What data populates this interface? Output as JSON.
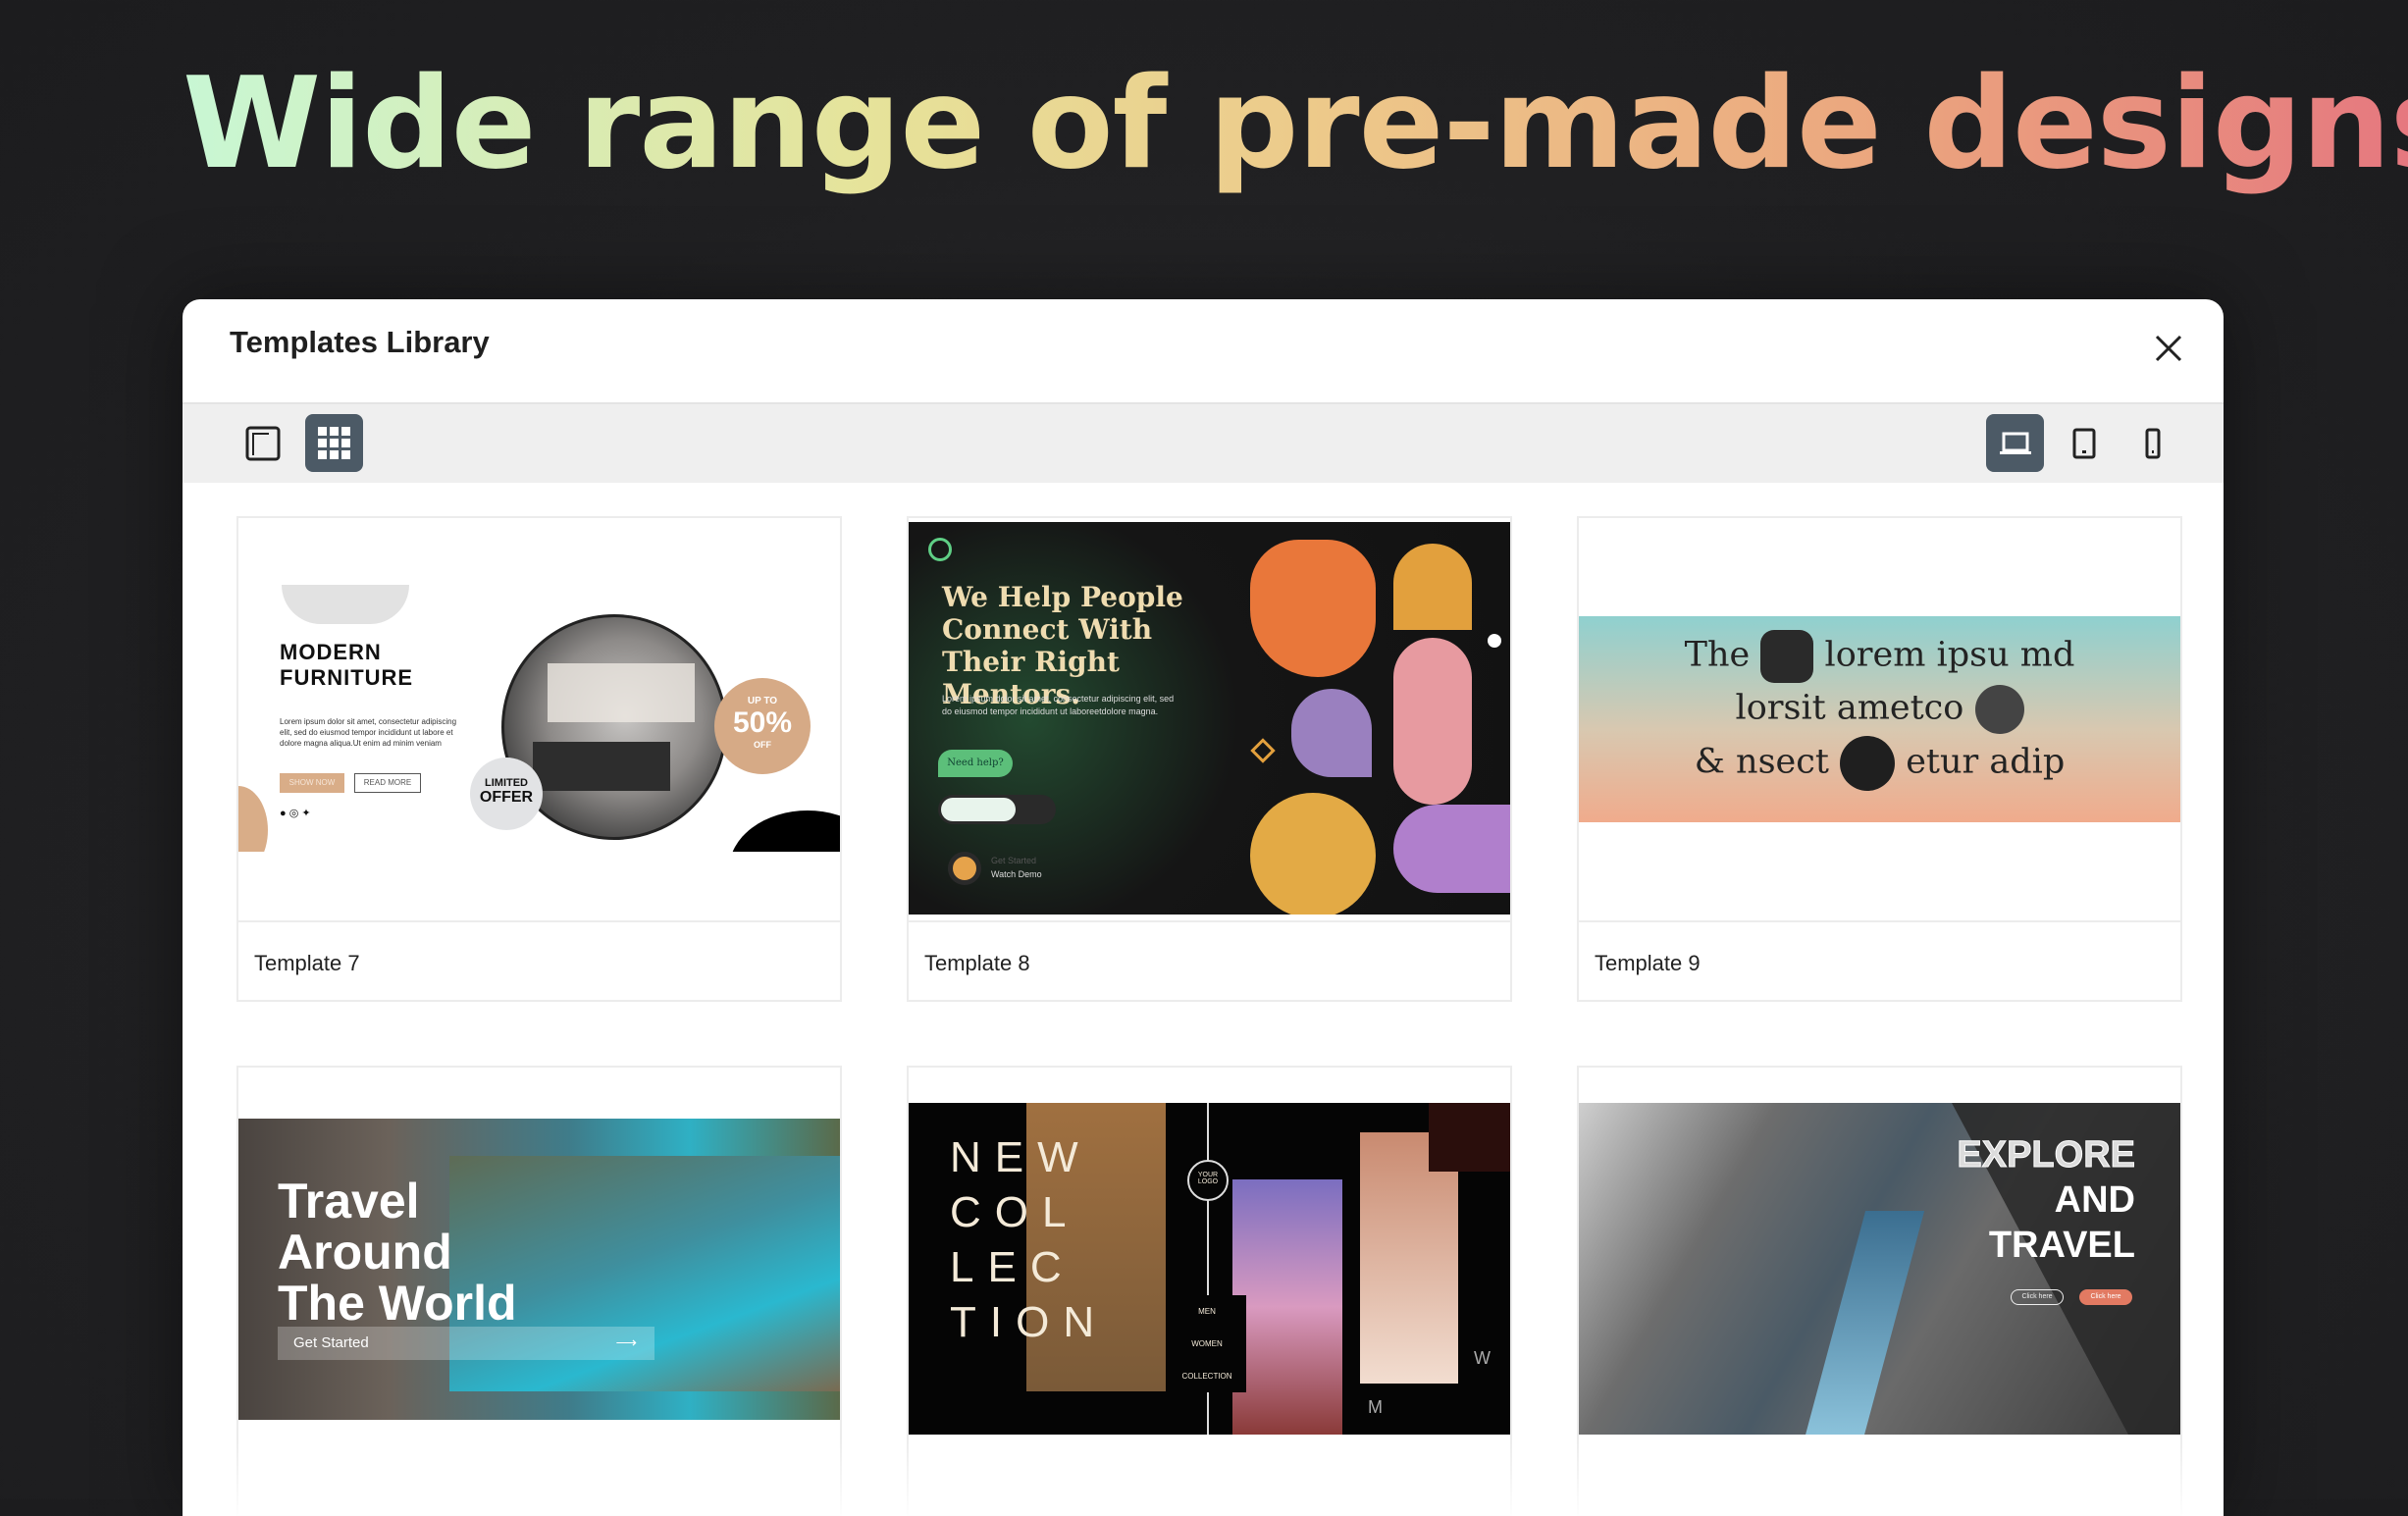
{
  "headline": "Wide range of pre-made designs",
  "modal": {
    "title": "Templates Library",
    "close_icon": "close-icon"
  },
  "toolbar": {
    "view_buttons": [
      {
        "icon": "single-view-icon",
        "active": false
      },
      {
        "icon": "grid-view-icon",
        "active": true
      }
    ],
    "device_buttons": [
      {
        "icon": "desktop-icon",
        "active": true
      },
      {
        "icon": "tablet-icon",
        "active": false
      },
      {
        "icon": "mobile-icon",
        "active": false
      }
    ]
  },
  "colors": {
    "active_button": "#4c5a66",
    "toolbar_bg": "#efefef"
  },
  "templates": [
    {
      "label": "Template 7",
      "thumb": {
        "heading1": "MODERN",
        "heading2": "FURNITURE",
        "body": "Lorem ipsum dolor sit amet, consectetur adipiscing elit, sed do eiusmod tempor incididunt ut labore et dolore magna aliqua.Ut enim ad minim veniam",
        "btn1": "SHOW NOW",
        "btn2": "READ MORE",
        "badge_top": "UP TO",
        "badge_value": "50%",
        "badge_bottom": "OFF",
        "offer1": "LIMITED",
        "offer2": "OFFER"
      }
    },
    {
      "label": "Template 8",
      "thumb": {
        "heading": "We Help People Connect With Their Right Mentors.",
        "body": "Lorem ipsum dolor sit amet, consectetur adipiscing elit, sed do eiusmod tempor incididunt ut laboreetdolore magna.",
        "help": "Need help?",
        "cta1": "Get Started",
        "cta2": "Watch Demo"
      }
    },
    {
      "label": "Template 9",
      "thumb": {
        "line1a": "The",
        "line1b": "lorem ipsu md",
        "line2": "lorsit ametco",
        "line3a": "& nsect",
        "line3b": "etur adip"
      }
    },
    {
      "label": "",
      "thumb": {
        "l1": "Travel",
        "l2": "Around",
        "l3": "The World",
        "cta": "Get Started"
      }
    },
    {
      "label": "",
      "thumb": {
        "l1": "NEW",
        "l2": "COL",
        "l3": "LEC",
        "l4": "TION",
        "logo": "YOUR LOGO",
        "m1": "MEN",
        "m2": "WOMEN",
        "m3": "COLLECTION",
        "w": "W",
        "m": "M"
      }
    },
    {
      "label": "",
      "thumb": {
        "l1": "EXPLORE",
        "l2": "AND",
        "l3": "TRAVEL",
        "b1": "Click here",
        "b2": "Click here"
      }
    }
  ]
}
